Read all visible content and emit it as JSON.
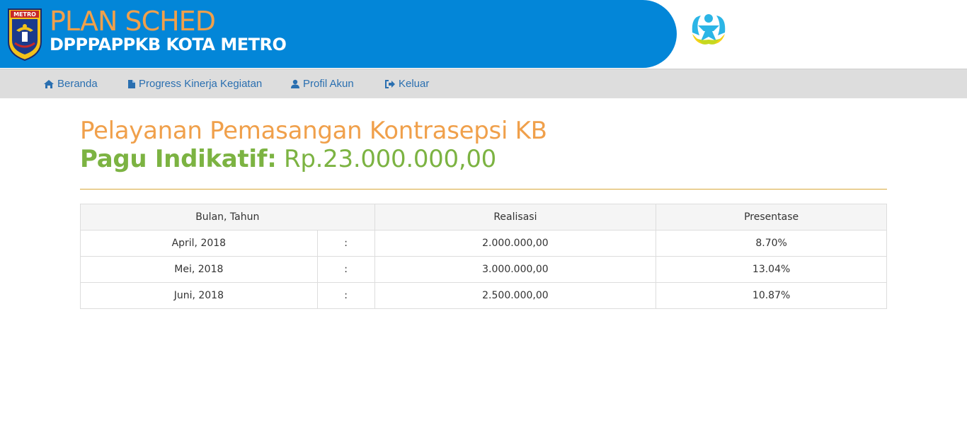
{
  "header": {
    "title": "PLAN SCHED",
    "subtitle": "DPPPAPPKB KOTA METRO",
    "crest_label": "METRO",
    "crest_icon": "city-crest-icon",
    "partner_logo_icon": "bkkbn-logo-icon",
    "banner_color": "#0386d8",
    "title_color": "#f0a04b"
  },
  "nav": {
    "items": [
      {
        "label": "Beranda",
        "icon": "home-icon"
      },
      {
        "label": "Progress Kinerja Kegiatan",
        "icon": "document-icon"
      },
      {
        "label": "Profil Akun",
        "icon": "user-icon"
      },
      {
        "label": "Keluar",
        "icon": "sign-out-icon"
      }
    ]
  },
  "main": {
    "activity_title": "Pelayanan Pemasangan Kontrasepsi KB",
    "pagu_label": "Pagu Indikatif:",
    "pagu_value": "Rp.23.000.000,00",
    "accent_color": "#7cb342",
    "divider_color": "#d9a83b"
  },
  "table": {
    "headers": [
      "Bulan, Tahun",
      "Realisasi",
      "Presentase"
    ],
    "rows": [
      {
        "period": "April, 2018",
        "sep": ":",
        "realisasi": "2.000.000,00",
        "presentase": "8.70%"
      },
      {
        "period": "Mei, 2018",
        "sep": ":",
        "realisasi": "3.000.000,00",
        "presentase": "13.04%"
      },
      {
        "period": "Juni, 2018",
        "sep": ":",
        "realisasi": "2.500.000,00",
        "presentase": "10.87%"
      }
    ]
  }
}
